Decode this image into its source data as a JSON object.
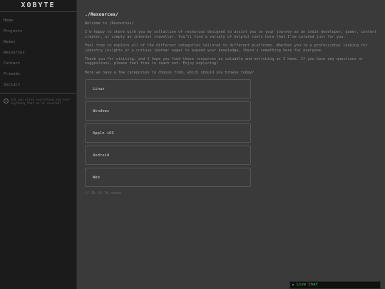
{
  "sidebar": {
    "logo": "XOBYTE",
    "nav": [
      {
        "label": "Home"
      },
      {
        "label": "Projects"
      },
      {
        "label": "Demos"
      },
      {
        "label": "Resources"
      },
      {
        "label": "Contact"
      },
      {
        "label": "Friends"
      },
      {
        "label": "Socials"
      }
    ],
    "info_text": "Did you enjoy everything and ever anything that we've covered?"
  },
  "main": {
    "title": "./Resources/",
    "welcome": "Welcome to /Resources/",
    "paragraphs": [
      "I'm happy to share with you my collection of resources designed to assist you on your journey as an indie developer, gamer, content creator, or simply an internet traveller. You'll find a variety of helpful tools here that I've curated just for you.",
      "Feel free to explore all of the different categories tailored to different platforms. Whether you're a professional looking for industry insights or a curious learner eager to expand your knowledge, there's something here for everyone.",
      "Thank you for visiting, and I hope you find these resources as valuable and enriching as I have. If you have any questions or suggestions, please feel free to reach out. Enjoy exploring!",
      "Here we have a few categories to choose from, which should you browse today?"
    ],
    "categories": [
      {
        "label": "Linux"
      },
      {
        "label": "Windows"
      },
      {
        "label": "Apple iOS"
      },
      {
        "label": "Android"
      },
      {
        "label": "Web"
      }
    ],
    "footer_note": "// 1k lk lk <zzz>"
  },
  "live_chat": {
    "label": "Live Chat",
    "color": "#58c47a"
  }
}
